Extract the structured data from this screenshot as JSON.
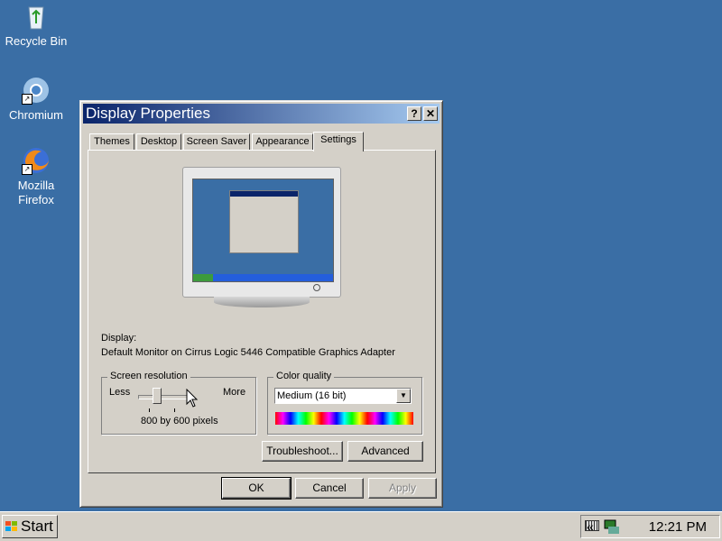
{
  "desktop": {
    "icons": [
      {
        "label": "Recycle Bin",
        "icon": "recycle-bin-icon"
      },
      {
        "label": "Chromium",
        "icon": "chromium-icon"
      },
      {
        "label": "Mozilla Firefox",
        "icon": "firefox-icon"
      }
    ],
    "background_color": "#3a6ea5"
  },
  "window": {
    "title": "Display Properties",
    "help_button": "?",
    "close_button": "✕",
    "tabs": [
      {
        "label": "Themes"
      },
      {
        "label": "Desktop"
      },
      {
        "label": "Screen Saver"
      },
      {
        "label": "Appearance"
      },
      {
        "label": "Settings",
        "active": true
      }
    ],
    "display_label": "Display:",
    "display_value": "Default Monitor on Cirrus Logic 5446 Compatible Graphics Adapter",
    "resolution": {
      "group_label": "Screen resolution",
      "less_label": "Less",
      "more_label": "More",
      "value_text": "800 by 600 pixels"
    },
    "color_quality": {
      "group_label": "Color quality",
      "selected": "Medium (16 bit)"
    },
    "buttons": {
      "troubleshoot": "Troubleshoot...",
      "advanced": "Advanced",
      "ok": "OK",
      "cancel": "Cancel",
      "apply": "Apply"
    }
  },
  "taskbar": {
    "start_label": "Start",
    "tray_chevron": "«",
    "clock": "12:21 PM"
  }
}
